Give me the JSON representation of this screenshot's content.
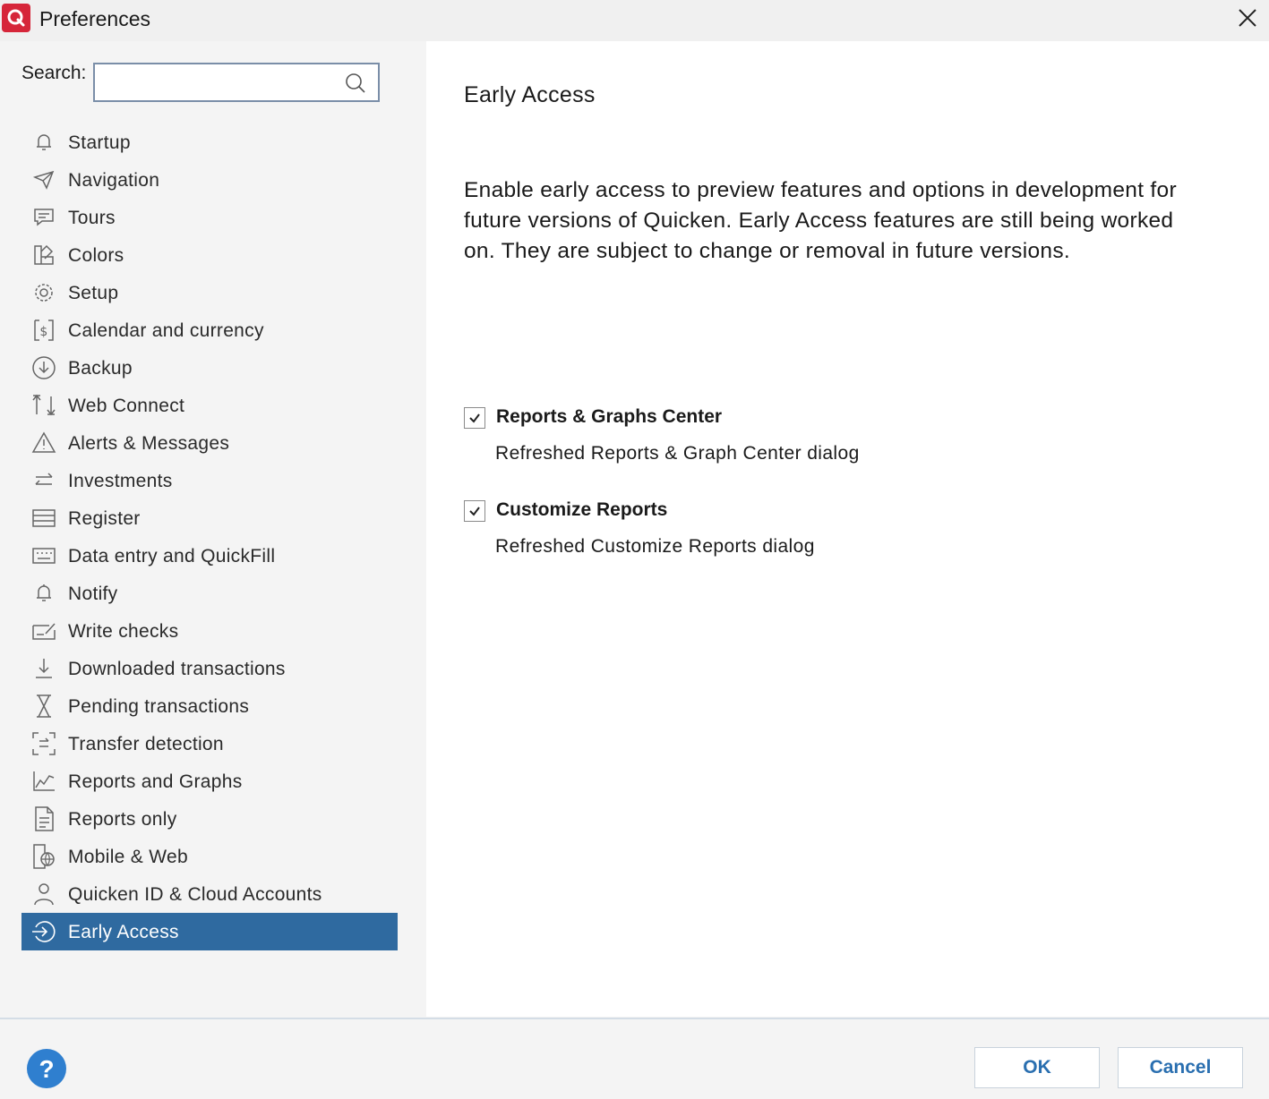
{
  "window": {
    "title": "Preferences"
  },
  "search": {
    "label": "Search:",
    "value": "",
    "placeholder": ""
  },
  "sidebar": {
    "items": [
      {
        "label": "Startup",
        "icon": "bell-icon"
      },
      {
        "label": "Navigation",
        "icon": "navigation-icon"
      },
      {
        "label": "Tours",
        "icon": "chat-icon"
      },
      {
        "label": "Colors",
        "icon": "palette-icon"
      },
      {
        "label": "Setup",
        "icon": "gear-icon"
      },
      {
        "label": "Calendar and currency",
        "icon": "calendar-dollar-icon"
      },
      {
        "label": "Backup",
        "icon": "backup-icon"
      },
      {
        "label": "Web Connect",
        "icon": "updown-arrows-icon"
      },
      {
        "label": "Alerts & Messages",
        "icon": "warning-icon"
      },
      {
        "label": "Investments",
        "icon": "swap-arrows-icon"
      },
      {
        "label": "Register",
        "icon": "register-icon"
      },
      {
        "label": "Data entry and QuickFill",
        "icon": "keyboard-icon"
      },
      {
        "label": "Notify",
        "icon": "notify-bell-icon"
      },
      {
        "label": "Write checks",
        "icon": "check-icon"
      },
      {
        "label": "Downloaded transactions",
        "icon": "download-icon"
      },
      {
        "label": "Pending transactions",
        "icon": "hourglass-icon"
      },
      {
        "label": "Transfer detection",
        "icon": "transfer-icon"
      },
      {
        "label": "Reports and Graphs",
        "icon": "chart-icon"
      },
      {
        "label": "Reports only",
        "icon": "document-icon"
      },
      {
        "label": "Mobile & Web",
        "icon": "mobile-icon"
      },
      {
        "label": "Quicken ID & Cloud Accounts",
        "icon": "user-icon"
      },
      {
        "label": "Early Access",
        "icon": "early-access-icon",
        "selected": true
      }
    ]
  },
  "main": {
    "title": "Early Access",
    "description": "Enable early access to preview features and options in development for future versions of Quicken. Early Access features are still being worked on. They are subject to change or removal in future versions.",
    "features": [
      {
        "title": "Reports & Graphs Center",
        "description": "Refreshed Reports & Graph Center dialog",
        "checked": true
      },
      {
        "title": "Customize Reports",
        "description": "Refreshed Customize Reports dialog",
        "checked": true
      }
    ]
  },
  "footer": {
    "ok_label": "OK",
    "cancel_label": "Cancel"
  },
  "colors": {
    "accent": "#2f6aa0",
    "brand": "#d6263a",
    "button_text": "#2a6fb0",
    "help": "#2f7fcf"
  }
}
